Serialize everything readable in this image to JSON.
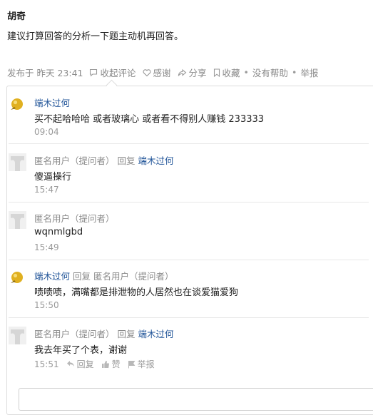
{
  "answer": {
    "author": "胡奇",
    "text": "建议打算回答的分析一下题主动机再回答。",
    "meta": {
      "published": "发布于 昨天 23:41",
      "collapse_comments": "收起评论",
      "thanks": "感谢",
      "share": "分享",
      "favorite": "收藏",
      "not_helpful": "没有帮助",
      "report": "举报",
      "dot": "•"
    }
  },
  "comments": [
    {
      "avatar_icon": "gold-ball-icon",
      "author": "端木过何",
      "text": "买不起哈哈哈 或者玻璃心 或者看不得别人赚钱 233333",
      "time": "09:04"
    },
    {
      "avatar_icon": "default-avatar-icon",
      "author": "匿名用户",
      "role": "（提问者）",
      "reply_word": "回复",
      "reply_to": "端木过何",
      "text": "傻逼操行",
      "time": "15:47"
    },
    {
      "avatar_icon": "default-avatar-icon",
      "author": "匿名用户",
      "role": "（提问者）",
      "text": "wqnmlgbd",
      "time": "15:49"
    },
    {
      "avatar_icon": "gold-ball-icon",
      "author": "端木过何",
      "reply_word": "回复",
      "reply_to": "匿名用户",
      "reply_to_role": "（提问者）",
      "text": "啧啧啧，满嘴都是排泄物的人居然也在谈爱猫爱狗",
      "time": "15:50"
    },
    {
      "avatar_icon": "default-avatar-icon",
      "author": "匿名用户",
      "role": "（提问者）",
      "reply_word": "回复",
      "reply_to": "端木过何",
      "text": "我去年买了个表，谢谢",
      "time": "15:51",
      "actions": {
        "reply": "回复",
        "like": "赞",
        "report": "举报"
      }
    }
  ],
  "colors": {
    "link": "#225599",
    "muted": "#8a8a8a",
    "border": "#dcdcdc"
  }
}
